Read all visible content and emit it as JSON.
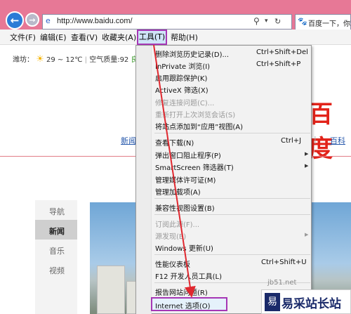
{
  "browser": {
    "address_url": "http://www.baidu.com/",
    "tab_title": "百度一下，你就知"
  },
  "menubar": {
    "items": [
      "文件(F)",
      "编辑(E)",
      "查看(V)",
      "收藏夹(A)",
      "工具(T)",
      "帮助(H)"
    ]
  },
  "page": {
    "weather": {
      "city": "潍坊：",
      "temp": "29 ~ 12℃",
      "air": "空气质量:92",
      "air_level": "良"
    },
    "logo_fragment": "百度",
    "nav_links": [
      "新闻",
      "百科"
    ],
    "left_nav": [
      "导航",
      "新闻",
      "音乐",
      "视频"
    ]
  },
  "tools_menu": {
    "items": [
      {
        "label": "删除浏览历史记录(D)...",
        "shortcut": "Ctrl+Shift+Del"
      },
      {
        "label": "InPrivate 浏览(I)",
        "shortcut": "Ctrl+Shift+P"
      },
      {
        "label": "启用跟踪保护(K)",
        "shortcut": ""
      },
      {
        "label": "ActiveX 筛选(X)",
        "shortcut": ""
      },
      {
        "label": "修复连接问题(C)...",
        "shortcut": ""
      },
      {
        "label": "重新打开上次浏览会话(S)",
        "shortcut": ""
      },
      {
        "label": "将站点添加到“应用”视图(A)",
        "shortcut": ""
      },
      {
        "label": "查看下载(N)",
        "shortcut": "Ctrl+J"
      },
      {
        "label": "弹出窗口阻止程序(P)",
        "shortcut": ""
      },
      {
        "label": "SmartScreen 筛选器(T)",
        "shortcut": ""
      },
      {
        "label": "管理媒体许可证(M)",
        "shortcut": ""
      },
      {
        "label": "管理加载项(A)",
        "shortcut": ""
      },
      {
        "label": "兼容性视图设置(B)",
        "shortcut": ""
      },
      {
        "label": "订阅此源(F)...",
        "shortcut": ""
      },
      {
        "label": "源发现(E)",
        "shortcut": ""
      },
      {
        "label": "Windows 更新(U)",
        "shortcut": ""
      },
      {
        "label": "性能仪表板",
        "shortcut": "Ctrl+Shift+U"
      },
      {
        "label": "F12 开发人员工具(L)",
        "shortcut": ""
      },
      {
        "label": "报告网站问题(R)",
        "shortcut": ""
      },
      {
        "label": "Internet 选项(O)",
        "shortcut": ""
      }
    ]
  },
  "watermark": {
    "text": "易采站长站",
    "logo": "易",
    "url_fragment": "jb51.net"
  },
  "colors": {
    "chrome_pink": "#e77896",
    "highlight_purple": "#a637b5",
    "arrow_red": "#e0282f",
    "link_blue": "#2255aa"
  }
}
